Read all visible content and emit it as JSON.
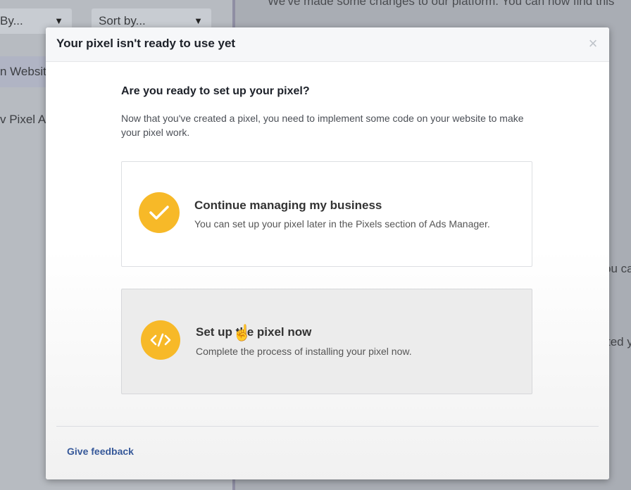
{
  "background": {
    "filter_left_label": "By...",
    "filter_sort_label": "Sort by...",
    "list_items": [
      "n Websit",
      "v Pixel Ac"
    ],
    "banner_text": "We've made some changes to our platform. You can now find this",
    "side_fragments": [
      "ou ca",
      "ted y"
    ]
  },
  "modal": {
    "title": "Your pixel isn't ready to use yet",
    "close_glyph": "×",
    "question": "Are you ready to set up your pixel?",
    "description": "Now that you've created a pixel, you need to implement some code on your website to make your pixel work.",
    "options": [
      {
        "icon": "checkmark-icon",
        "title": "Continue managing my business",
        "subtitle": "You can set up your pixel later in the Pixels section of Ads Manager."
      },
      {
        "icon": "code-icon",
        "title": "Set up the pixel now",
        "subtitle": "Complete the process of installing your pixel now."
      }
    ],
    "feedback_label": "Give feedback"
  },
  "colors": {
    "accent_yellow": "#f7b928",
    "link_blue": "#365899"
  }
}
